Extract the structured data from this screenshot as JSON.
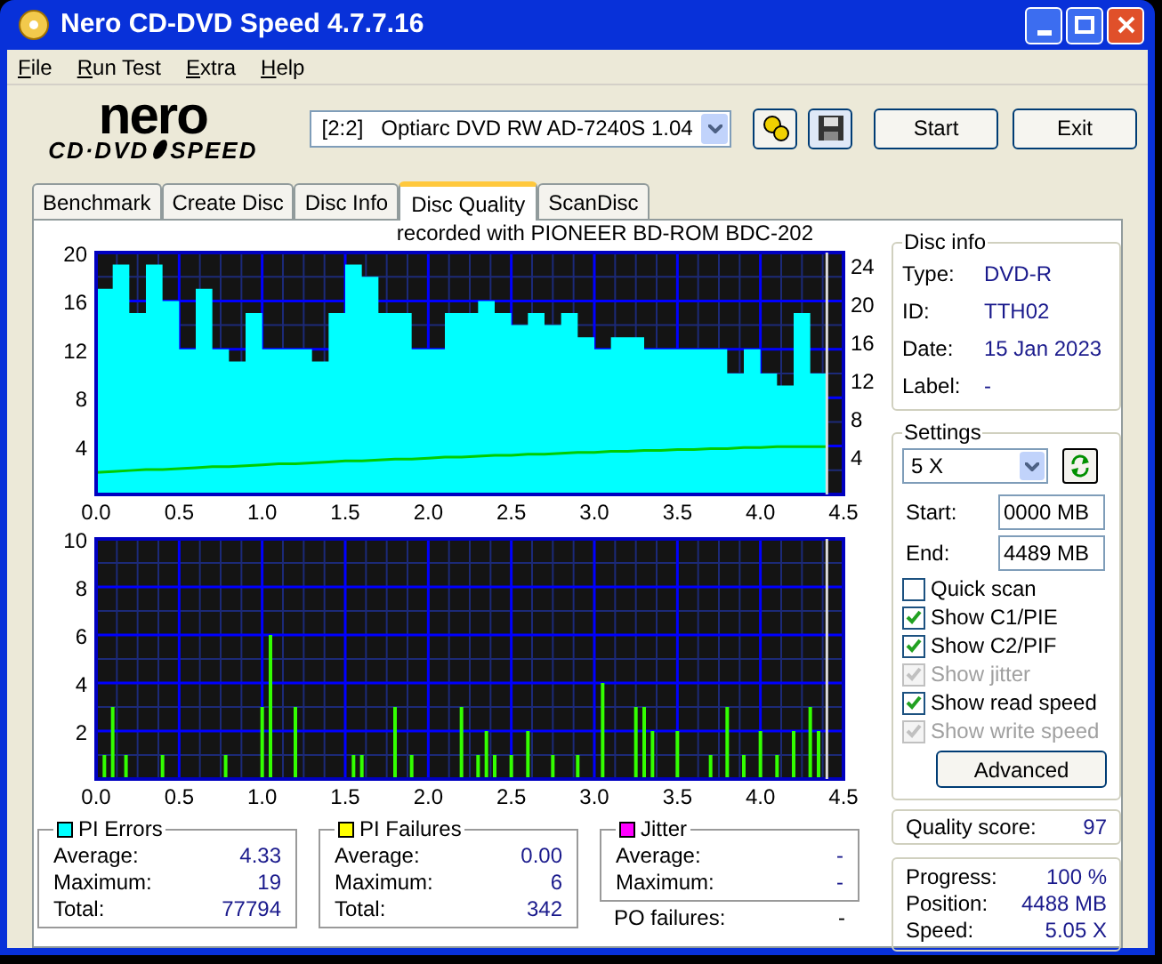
{
  "window": {
    "title": "Nero CD-DVD Speed 4.7.7.16"
  },
  "menu": [
    {
      "label": "File"
    },
    {
      "label": "Run Test"
    },
    {
      "label": "Extra"
    },
    {
      "label": "Help"
    }
  ],
  "logo": {
    "top": "nero",
    "bottom": "CD·DVD",
    "bottom_right": "SPEED"
  },
  "toolbar": {
    "drive": "[2:2]   Optiarc DVD RW AD-7240S 1.04",
    "buttons": [
      "Start",
      "Exit"
    ]
  },
  "tabs": [
    {
      "label": "Benchmark",
      "selected": false
    },
    {
      "label": "Create Disc",
      "selected": false
    },
    {
      "label": "Disc Info",
      "selected": false
    },
    {
      "label": "Disc Quality",
      "selected": true
    },
    {
      "label": "ScanDisc",
      "selected": false
    }
  ],
  "chart_caption": "recorded with PIONEER  BD-ROM  BDC-202",
  "upper_chart": {
    "chart_data": {
      "type": "area",
      "grid": true,
      "ref_lines": [
        {
          "axis": "x",
          "value": 4.4,
          "color": "#dddddd"
        }
      ],
      "y2lim": [
        0,
        25.3
      ],
      "y2ticks": [
        4,
        8,
        12,
        16,
        20,
        24
      ],
      "x": [
        0,
        0.1,
        0.2,
        0.3,
        0.4,
        0.5,
        0.6,
        0.7,
        0.8,
        0.9,
        1.0,
        1.1,
        1.2,
        1.3,
        1.4,
        1.5,
        1.6,
        1.7,
        1.8,
        1.9,
        2.0,
        2.1,
        2.2,
        2.3,
        2.4,
        2.5,
        2.6,
        2.7,
        2.8,
        2.9,
        3.0,
        3.1,
        3.2,
        3.3,
        3.4,
        3.5,
        3.6,
        3.7,
        3.8,
        3.9,
        4.0,
        4.1,
        4.2,
        4.3,
        4.4
      ],
      "series": [
        {
          "color": "#00ffff",
          "values": [
            17,
            19,
            15,
            19,
            16,
            12,
            17,
            12,
            11,
            15,
            12,
            12,
            12,
            11,
            15,
            19,
            18,
            15,
            15,
            12,
            12,
            15,
            15,
            16,
            15,
            14,
            15,
            14,
            15,
            13,
            12,
            13,
            13,
            12,
            12,
            12,
            12,
            12,
            10,
            12,
            10,
            9,
            15,
            10,
            9
          ]
        },
        {
          "color": "#00cc00",
          "type": "line",
          "axis": "y2",
          "values": [
            2.3,
            2.4,
            2.5,
            2.6,
            2.6,
            2.7,
            2.8,
            2.9,
            2.9,
            3.0,
            3.1,
            3.2,
            3.2,
            3.3,
            3.4,
            3.5,
            3.5,
            3.6,
            3.7,
            3.7,
            3.8,
            3.9,
            3.9,
            4.0,
            4.1,
            4.1,
            4.2,
            4.2,
            4.3,
            4.4,
            4.4,
            4.5,
            4.5,
            4.6,
            4.6,
            4.7,
            4.7,
            4.8,
            4.8,
            4.9,
            4.9,
            5.0,
            5.0,
            5.0,
            5.0
          ]
        }
      ],
      "xlim": [
        0,
        4.5
      ],
      "ylim": [
        0,
        20
      ],
      "xticks": [
        {
          "value": 0,
          "label": "0.0"
        },
        {
          "value": 0.5,
          "label": "0.5"
        },
        {
          "value": 1,
          "label": "1.0"
        },
        {
          "value": 1.5,
          "label": "1.5"
        },
        {
          "value": 2,
          "label": "2.0"
        },
        {
          "value": 2.5,
          "label": "2.5"
        },
        {
          "value": 3,
          "label": "3.0"
        },
        {
          "value": 3.5,
          "label": "3.5"
        },
        {
          "value": 4,
          "label": "4.0"
        },
        {
          "value": 4.5,
          "label": "4.5"
        }
      ],
      "yticks": [
        4,
        8,
        12,
        16,
        20
      ]
    }
  },
  "lower_chart": {
    "chart_data": {
      "type": "bar",
      "grid": true,
      "ref_lines": [
        {
          "axis": "x",
          "value": 4.4,
          "color": "#dddddd"
        }
      ],
      "x": [
        0.05,
        0.1,
        0.18,
        0.4,
        0.78,
        1.0,
        1.05,
        1.2,
        1.55,
        1.6,
        1.8,
        1.9,
        2.2,
        2.3,
        2.35,
        2.4,
        2.5,
        2.6,
        2.75,
        2.9,
        3.05,
        3.25,
        3.3,
        3.35,
        3.5,
        3.7,
        3.8,
        3.9,
        4.0,
        4.1,
        4.2,
        4.3,
        4.35
      ],
      "series": [
        {
          "color": "#33ff00",
          "values": [
            1,
            3,
            1,
            1,
            1,
            3,
            6,
            3,
            1,
            1,
            3,
            1,
            3,
            1,
            2,
            1,
            1,
            2,
            1,
            1,
            4,
            3,
            3,
            2,
            2,
            1,
            3,
            1,
            2,
            1,
            2,
            3,
            2
          ]
        }
      ],
      "xlim": [
        0,
        4.5
      ],
      "ylim": [
        0,
        10
      ],
      "xticks": [
        {
          "value": 0,
          "label": "0.0"
        },
        {
          "value": 0.5,
          "label": "0.5"
        },
        {
          "value": 1,
          "label": "1.0"
        },
        {
          "value": 1.5,
          "label": "1.5"
        },
        {
          "value": 2,
          "label": "2.0"
        },
        {
          "value": 2.5,
          "label": "2.5"
        },
        {
          "value": 3,
          "label": "3.0"
        },
        {
          "value": 3.5,
          "label": "3.5"
        },
        {
          "value": 4,
          "label": "4.0"
        },
        {
          "value": 4.5,
          "label": "4.5"
        }
      ],
      "yticks": [
        2,
        4,
        6,
        8,
        10
      ]
    }
  },
  "stats": [
    {
      "title": "PI Errors",
      "color": "#00ffff",
      "rows": [
        {
          "label": "Average:",
          "value": "4.33"
        },
        {
          "label": "Maximum:",
          "value": "19"
        },
        {
          "label": "Total:",
          "value": "77794"
        }
      ]
    },
    {
      "title": "PI Failures",
      "color": "#ffff00",
      "rows": [
        {
          "label": "Average:",
          "value": "0.00"
        },
        {
          "label": "Maximum:",
          "value": "6"
        },
        {
          "label": "Total:",
          "value": "342"
        }
      ]
    },
    {
      "title": "Jitter",
      "color": "#ff00ff",
      "rows": [
        {
          "label": "Average:",
          "value": "-"
        },
        {
          "label": "Maximum:",
          "value": "-"
        }
      ]
    }
  ],
  "po_failures": {
    "label": "PO failures:",
    "value": "-"
  },
  "disc_info": {
    "title": "Disc info",
    "rows": [
      {
        "label": "Type:",
        "value": "DVD-R"
      },
      {
        "label": "ID:",
        "value": "TTH02"
      },
      {
        "label": "Date:",
        "value": "15 Jan 2023"
      },
      {
        "label": "Label:",
        "value": "-"
      }
    ]
  },
  "settings": {
    "title": "Settings",
    "speed": "5 X",
    "start_label": "Start:",
    "start": "0000 MB",
    "end_label": "End:",
    "end": "4489 MB",
    "options": [
      {
        "label": "Quick scan",
        "checked": false,
        "disabled": false
      },
      {
        "label": "Show C1/PIE",
        "checked": true,
        "disabled": false
      },
      {
        "label": "Show C2/PIF",
        "checked": true,
        "disabled": false
      },
      {
        "label": "Show jitter",
        "checked": true,
        "disabled": true
      },
      {
        "label": "Show read speed",
        "checked": true,
        "disabled": false
      },
      {
        "label": "Show write speed",
        "checked": true,
        "disabled": true
      }
    ],
    "advanced": "Advanced"
  },
  "quality": {
    "label": "Quality score:",
    "value": "97"
  },
  "progress": [
    {
      "label": "Progress:",
      "value": "100 %"
    },
    {
      "label": "Position:",
      "value": "4488 MB"
    },
    {
      "label": "Speed:",
      "value": "5.05 X"
    }
  ]
}
